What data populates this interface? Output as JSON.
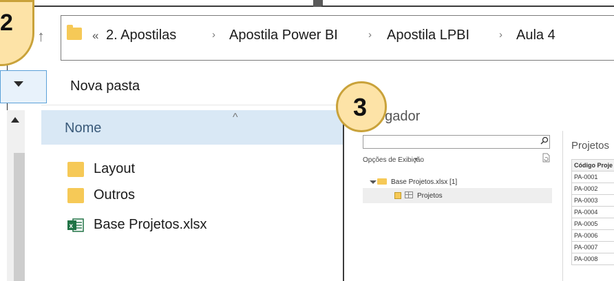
{
  "callouts": {
    "step2": "2",
    "step3": "3"
  },
  "address_bar": {
    "overflow": "«",
    "crumbs": [
      "2. Apostilas",
      "Apostila Power BI",
      "Apostila LPBI",
      "Aula 4"
    ],
    "separator": "›"
  },
  "toolbar": {
    "new_folder": "Nova pasta"
  },
  "file_list": {
    "column_name": "Nome",
    "items": [
      {
        "name": "Layout",
        "type": "folder"
      },
      {
        "name": "Outros",
        "type": "folder"
      },
      {
        "name": "Base Projetos.xlsx",
        "type": "excel"
      }
    ]
  },
  "navigator": {
    "title_partial": "egador",
    "display_options": "Opções de Exibição",
    "tree": [
      {
        "label": "Base Projetos.xlsx [1]"
      },
      {
        "label": "Projetos",
        "checked": true
      }
    ],
    "preview_title": "Projetos",
    "preview_header": "Código Proje",
    "preview_rows": [
      "PA-0001",
      "PA-0002",
      "PA-0003",
      "PA-0004",
      "PA-0005",
      "PA-0006",
      "PA-0007",
      "PA-0008"
    ]
  },
  "colors": {
    "folder": "#f6c957",
    "accent": "#5aa0d8",
    "callout_fill": "#fde3a7",
    "callout_border": "#c9a23a"
  }
}
